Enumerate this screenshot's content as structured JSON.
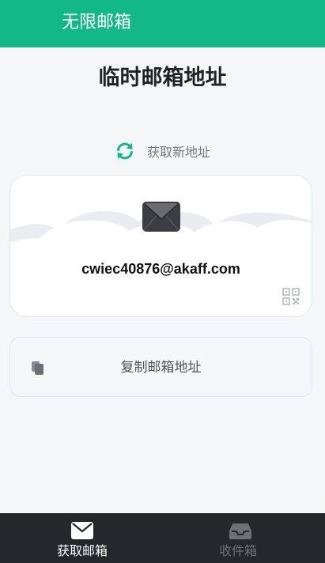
{
  "header": {
    "title": "无限邮箱"
  },
  "main": {
    "page_title": "临时邮箱地址",
    "refresh": {
      "label": "获取新地址",
      "icon": "refresh-icon"
    },
    "email_card": {
      "address": "cwiec40876@akaff.com",
      "mail_icon": "mail-icon",
      "qr_icon": "qr-code-icon"
    },
    "copy_button": {
      "label": "复制邮箱地址",
      "icon": "copy-icon"
    }
  },
  "tabbar": {
    "tabs": [
      {
        "label": "获取邮箱",
        "icon": "envelope-icon",
        "active": true
      },
      {
        "label": "收件箱",
        "icon": "inbox-icon",
        "active": false
      }
    ]
  },
  "colors": {
    "brand_green": "#12b886",
    "tabbar_bg": "#26272b",
    "tab_active": "#ffffff",
    "tab_inactive": "#6f7075"
  }
}
